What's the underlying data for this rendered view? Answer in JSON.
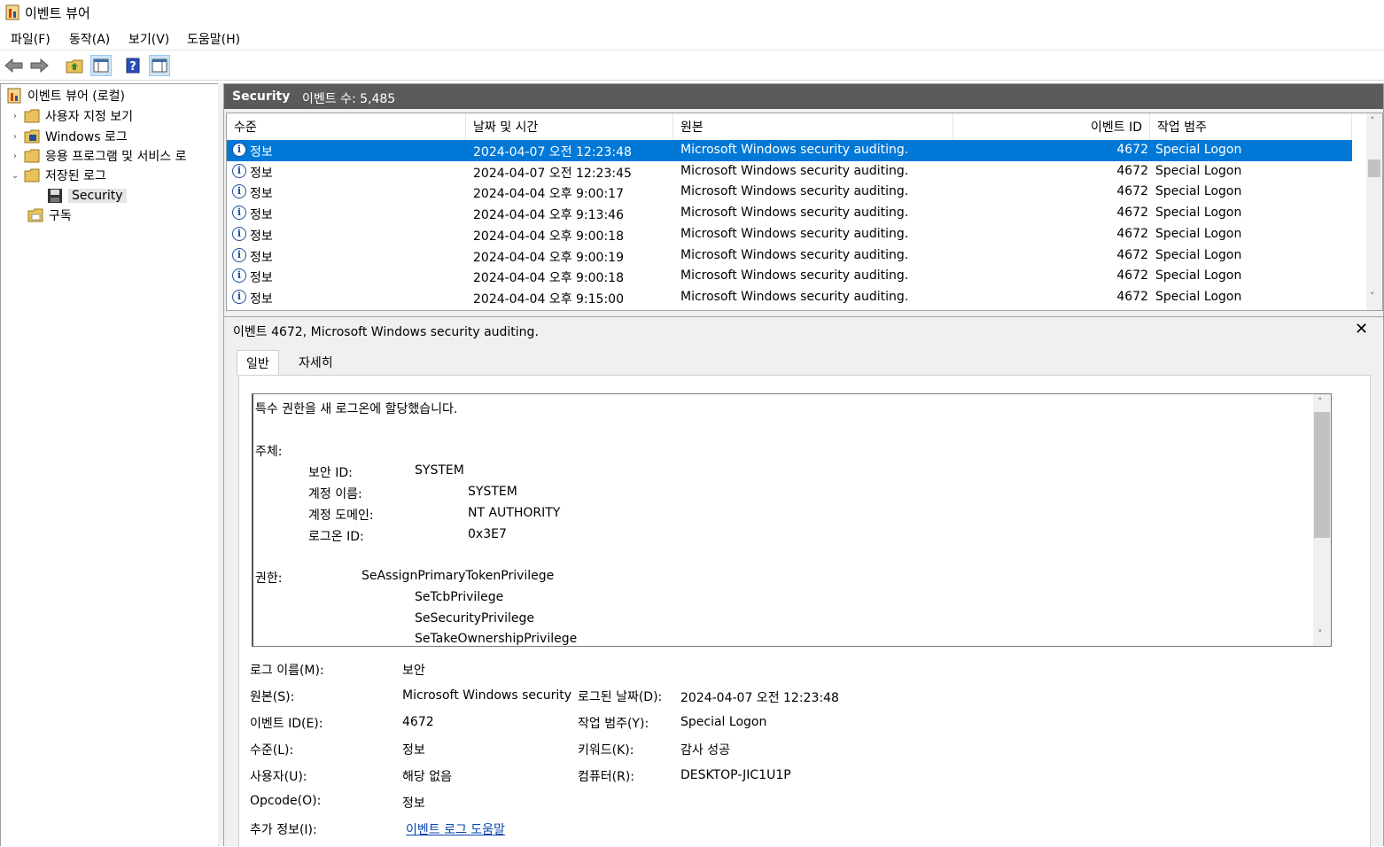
{
  "window": {
    "title": "이벤트 뷰어"
  },
  "menu": [
    "파일(F)",
    "동작(A)",
    "보기(V)",
    "도움말(H)"
  ],
  "toolbar": {
    "buttons": [
      "back-icon",
      "forward-icon",
      "folder-up-icon",
      "show-hide-console-tree-icon",
      "help-icon",
      "show-hide-action-pane-icon"
    ]
  },
  "tree": {
    "root": "이벤트 뷰어 (로컬)",
    "items": [
      "사용자 지정 보기",
      "Windows 로그",
      "응용 프로그램 및 서비스 로",
      "저장된 로그"
    ],
    "saved_child": "Security",
    "subscriptions": "구독"
  },
  "grid": {
    "name": "Security",
    "count_label": "이벤트 수: 5,485",
    "columns": [
      "수준",
      "날짜 및 시간",
      "원본",
      "이벤트 ID",
      "작업 범주"
    ],
    "rows": [
      {
        "level": "정보",
        "datetime": "2024-04-07 오전 12:23:48",
        "source": "Microsoft Windows security auditing.",
        "id": "4672",
        "category": "Special Logon"
      },
      {
        "level": "정보",
        "datetime": "2024-04-07 오전 12:23:45",
        "source": "Microsoft Windows security auditing.",
        "id": "4672",
        "category": "Special Logon"
      },
      {
        "level": "정보",
        "datetime": "2024-04-04 오후 9:00:17",
        "source": "Microsoft Windows security auditing.",
        "id": "4672",
        "category": "Special Logon"
      },
      {
        "level": "정보",
        "datetime": "2024-04-04 오후 9:13:46",
        "source": "Microsoft Windows security auditing.",
        "id": "4672",
        "category": "Special Logon"
      },
      {
        "level": "정보",
        "datetime": "2024-04-04 오후 9:00:18",
        "source": "Microsoft Windows security auditing.",
        "id": "4672",
        "category": "Special Logon"
      },
      {
        "level": "정보",
        "datetime": "2024-04-04 오후 9:00:19",
        "source": "Microsoft Windows security auditing.",
        "id": "4672",
        "category": "Special Logon"
      },
      {
        "level": "정보",
        "datetime": "2024-04-04 오후 9:00:18",
        "source": "Microsoft Windows security auditing.",
        "id": "4672",
        "category": "Special Logon"
      },
      {
        "level": "정보",
        "datetime": "2024-04-04 오후 9:15:00",
        "source": "Microsoft Windows security auditing.",
        "id": "4672",
        "category": "Special Logon"
      }
    ]
  },
  "detail": {
    "title": "이벤트 4672, Microsoft Windows security auditing.",
    "tabs": [
      "일반",
      "자세히"
    ],
    "description": {
      "line1": "특수 권한을 새 로그온에 할당했습니다.",
      "subject": "주체:",
      "sid_label": "보안 ID:",
      "sid": "SYSTEM",
      "acct_label": "계정 이름:",
      "acct": "SYSTEM",
      "domain_label": "계정 도메인:",
      "domain": "NT AUTHORITY",
      "logon_label": "로그온 ID:",
      "logon": "0x3E7",
      "priv_label": "권한:",
      "privileges": [
        "SeAssignPrimaryTokenPrivilege",
        "SeTcbPrivilege",
        "SeSecurityPrivilege",
        "SeTakeOwnershipPrivilege"
      ]
    },
    "fields": {
      "log_name_label": "로그 이름(M):",
      "log_name": "보안",
      "source_label": "원본(S):",
      "source": "Microsoft Windows security",
      "logged_label": "로그된 날짜(D):",
      "logged": "2024-04-07 오전 12:23:48",
      "event_id_label": "이벤트 ID(E):",
      "event_id": "4672",
      "task_label": "작업 범주(Y):",
      "task": "Special Logon",
      "level_label": "수준(L):",
      "level": "정보",
      "keywords_label": "키워드(K):",
      "keywords": "감사 성공",
      "user_label": "사용자(U):",
      "user": "해당 없음",
      "computer_label": "컴퓨터(R):",
      "computer": "DESKTOP-JIC1U1P",
      "opcode_label": "Opcode(O):",
      "opcode": "정보",
      "more_label": "추가 정보(I):",
      "more_link": "이벤트 로그 도움말"
    }
  }
}
